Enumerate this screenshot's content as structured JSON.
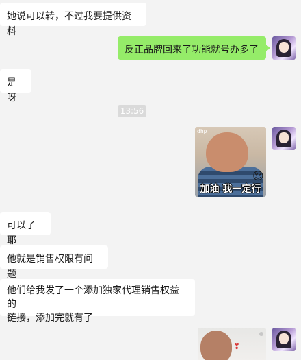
{
  "messages": {
    "m1": "她说可以转，不过我要提供资料",
    "m2": "反正品牌回来了功能就号办多了",
    "m3": "是呀",
    "time": "13:56",
    "sticker_tag": "dhp",
    "sticker_caption": "加油 我一定行",
    "sticker_emoji": "😌",
    "m4": "可以了耶",
    "m5": "他就是销售权限有问题",
    "m6_line1": "他们给我发了一个添加独家代理销售权益的",
    "m6_line2": "链接，添加完就有了",
    "photo_flower": "❣"
  },
  "colors": {
    "background": "#f3f3f3",
    "my_bubble": "#95ec69",
    "other_bubble": "#ffffff"
  },
  "icons": {
    "avatar": "user-avatar-icon",
    "sticker": "sticker-image",
    "photo": "photo-image"
  }
}
